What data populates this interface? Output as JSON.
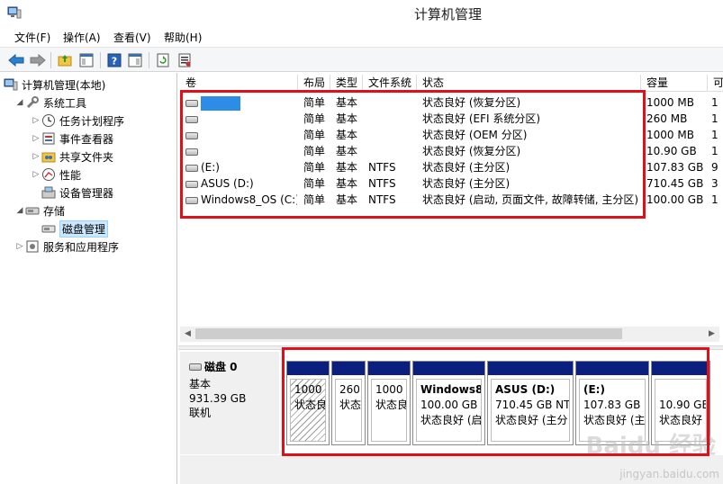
{
  "window": {
    "title": "计算机管理"
  },
  "menu": {
    "file": "文件(F)",
    "action": "操作(A)",
    "view": "查看(V)",
    "help": "帮助(H)"
  },
  "tree": {
    "root": "计算机管理(本地)",
    "system_tools": "系统工具",
    "task_scheduler": "任务计划程序",
    "event_viewer": "事件查看器",
    "shared_folders": "共享文件夹",
    "performance": "性能",
    "device_manager": "设备管理器",
    "storage": "存储",
    "disk_management": "磁盘管理",
    "services_apps": "服务和应用程序"
  },
  "volume_table": {
    "headers": [
      "卷",
      "布局",
      "类型",
      "文件系统",
      "状态",
      "容量",
      "可"
    ],
    "rows": [
      {
        "volume": "",
        "layout": "简单",
        "type": "基本",
        "fs": "",
        "status": "状态良好 (恢复分区)",
        "capacity": "1000 MB",
        "free": "1"
      },
      {
        "volume": "",
        "layout": "简单",
        "type": "基本",
        "fs": "",
        "status": "状态良好 (EFI 系统分区)",
        "capacity": "260 MB",
        "free": "1"
      },
      {
        "volume": "",
        "layout": "简单",
        "type": "基本",
        "fs": "",
        "status": "状态良好 (OEM 分区)",
        "capacity": "1000 MB",
        "free": "1"
      },
      {
        "volume": "",
        "layout": "简单",
        "type": "基本",
        "fs": "",
        "status": "状态良好 (恢复分区)",
        "capacity": "10.90 GB",
        "free": "1"
      },
      {
        "volume": "(E:)",
        "layout": "简单",
        "type": "基本",
        "fs": "NTFS",
        "status": "状态良好 (主分区)",
        "capacity": "107.83 GB",
        "free": "9"
      },
      {
        "volume": "ASUS (D:)",
        "layout": "简单",
        "type": "基本",
        "fs": "NTFS",
        "status": "状态良好 (主分区)",
        "capacity": "710.45 GB",
        "free": "3"
      },
      {
        "volume": "Windows8_OS (C:)",
        "layout": "简单",
        "type": "基本",
        "fs": "NTFS",
        "status": "状态良好 (启动, 页面文件, 故障转储, 主分区)",
        "capacity": "100.00 GB",
        "free": "1"
      }
    ]
  },
  "disk": {
    "name": "磁盘 0",
    "type": "基本",
    "size": "931.39 GB",
    "state": "联机",
    "partitions": [
      {
        "title": "",
        "size": "1000 I",
        "status": "状态良"
      },
      {
        "title": "",
        "size": "260",
        "status": "状态"
      },
      {
        "title": "",
        "size": "1000 I",
        "status": "状态良"
      },
      {
        "title": "Windows8_",
        "size": "100.00 GB I",
        "status": "状态良好 (启"
      },
      {
        "title": "ASUS  (D:)",
        "size": "710.45 GB NTI",
        "status": "状态良好 (主分"
      },
      {
        "title": "(E:)",
        "size": "107.83 GB I",
        "status": "状态良好 (主"
      },
      {
        "title": "",
        "size": "10.90 GB",
        "status": "状态良好"
      }
    ]
  },
  "watermark": {
    "main": "Baidu 经验",
    "sub": "jingyan.baidu.com"
  },
  "colors": {
    "partition_bar": "#0a1f7e",
    "highlight": "#e0101a",
    "selection": "#cce8ff"
  }
}
